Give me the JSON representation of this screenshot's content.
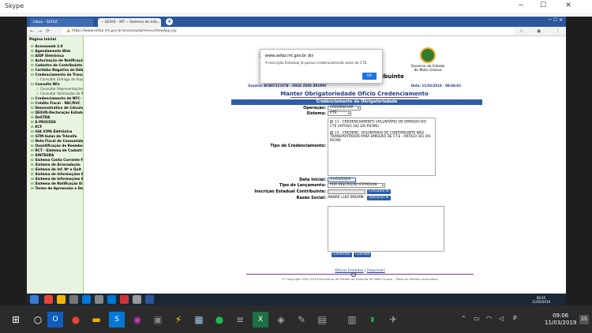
{
  "skype": {
    "title": "Skype",
    "min": "−",
    "max": "☐",
    "close": "✕"
  },
  "browser": {
    "tabs": [
      {
        "label": "Inbox - SEFAZ"
      },
      {
        "label": "-- SEFAZ - MT -- Sistema de Info..."
      }
    ],
    "url": "https://www.sefaz.mt.gov.br/acessoweb/menu/ViewApp.jsp",
    "lock_glyph": "🔒"
  },
  "menu": {
    "header": "Página Inicial",
    "items": [
      {
        "label": "Acessoweb 2.0",
        "sub": false
      },
      {
        "label": "Agendamento Web",
        "sub": false
      },
      {
        "label": "AIDF Eletrônica",
        "sub": false
      },
      {
        "label": "Autorização de Notificaçã",
        "sub": false
      },
      {
        "label": "Cadastro de Contribuinte",
        "sub": false
      },
      {
        "label": "Certidão Negativa de Déb",
        "sub": false
      },
      {
        "label": "Credenciamento de Transp",
        "sub": false
      },
      {
        "label": "Consultar Entrega de Arquivo",
        "sub": true
      },
      {
        "label": "Consulta NFe",
        "sub": false
      },
      {
        "label": "Consultar Representações",
        "sub": true
      },
      {
        "label": "Consultar Solicitação de Rec",
        "sub": true
      },
      {
        "label": "Credenciamento de NFC-",
        "sub": false
      },
      {
        "label": "Crédito Fiscal - PAC/RUC",
        "sub": false
      },
      {
        "label": "Demonstrativo de Cálculo",
        "sub": false
      },
      {
        "label": "DESVR-Declaração Estadu",
        "sub": false
      },
      {
        "label": "DeSTDA",
        "sub": false
      },
      {
        "label": "E-PROCESS",
        "sub": false
      },
      {
        "label": "ECF",
        "sub": false
      },
      {
        "label": "GIA ICMS Eletrônica",
        "sub": false
      },
      {
        "label": "GTM-Guias de Trânsito",
        "sub": false
      },
      {
        "label": "Nota Fiscal de Consumido",
        "sub": false
      },
      {
        "label": "Quantificação de Reembol",
        "sub": false
      },
      {
        "label": "RCT - Sistema de Cadastr",
        "sub": false
      },
      {
        "label": "SINTEGRA",
        "sub": false
      },
      {
        "label": "Sistema Conta Corrente F",
        "sub": false
      },
      {
        "label": "Sistema de Arrecadação",
        "sub": false
      },
      {
        "label": "Sistema de Inf. Nº e Quit",
        "sub": false
      },
      {
        "label": "Sistema de Informações E",
        "sub": false
      },
      {
        "label": "Sistema de Informações E",
        "sub": false
      },
      {
        "label": "Sistema de Notificação El",
        "sub": false
      },
      {
        "label": "Termo de Apreensão e Dej",
        "sub": false
      }
    ]
  },
  "header": {
    "s_letter": "S",
    "gov_line1": "Governo do Estado",
    "gov_line2": "de Mato Grosso",
    "contrib_suffix": "ibuinte",
    "info_left": "Usuário: BCBEF31287B - ENGE ZERE BRUMH",
    "info_right": "Data: 11/03/2019 - 09:04:02"
  },
  "page": {
    "title": "Manter Obrigatoriedade Ofício Credenciamento",
    "section": "Credenciamento de Obrigatoriedade"
  },
  "form": {
    "operacao_label": "Operação:",
    "operacao_value": "CREDENCIAR",
    "sistema_label": "Sistema:",
    "sistema_value": "CTE",
    "tipo_cred_label": "Tipo de Credenciamento:",
    "option1": "11 - CREDENCIAMENTO VOLUNTÁRIO DE EMISSÃO DO CTE (ARTIGO 341 DO RICMS)",
    "option2": "13 - CREDENC. VOLUNTÁRIO DE CONTRIBUINTE NÃO TRANSPORTADOR PARA EMISSÃO DE CT-E - ARTIGO 341 DO RICMS",
    "data_inicial_label": "Data Inicial:",
    "data_inicial_value": "11/03/2019",
    "tipo_lanc_label": "Tipo do Lançamento:",
    "tipo_lanc_value": "POR INSCRIÇÃO ESTADUAL",
    "ie_label": "Inscrição Estadual Contribuinte:",
    "ie_value": "",
    "consultar_ie": "Consultar IE",
    "razao_label": "Razão Social:",
    "razao_value": "ANDRÉ LUIZ BREMM",
    "adicionar_ie": "Adicionar IE",
    "confirmar": "Confirmar",
    "cancelar": "Cancelar"
  },
  "footer": {
    "link1": "Ofícios Emitidos",
    "sep": "|",
    "link2": "[Imprimir]",
    "copyright": "© Copyright 2001-2019 Secretaria de Estado de Fazenda de Mato Grosso - Todos os direitos reservados"
  },
  "alert": {
    "host": "www.sefaz.mt.gov.br diz",
    "message": "A Inscrição Estadual já possui credenciamento ativo de CTE.",
    "ok": "OK"
  },
  "remote_clock": {
    "time": "08:45",
    "date": "11/03/2019"
  },
  "taskbar": {
    "time": "09:06",
    "date": "11/03/2019",
    "notif_count": "25"
  },
  "colors": {
    "accent": "#2d5ea8",
    "menu_bg": "#e8f4e0",
    "title": "#1f3c88"
  }
}
